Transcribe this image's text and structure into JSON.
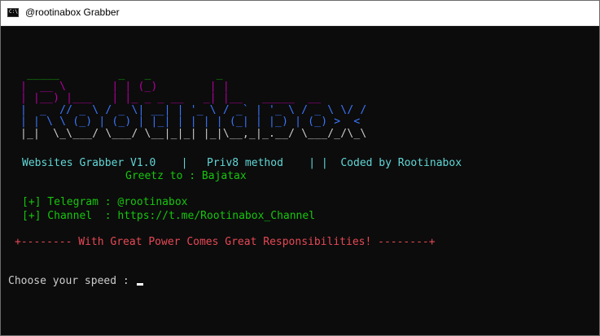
{
  "window": {
    "title": "@rootinabox Grabber",
    "icon_label": "C:\\."
  },
  "banner": {
    "lines": [
      {
        "text": " _____         _   _          _",
        "color": "#13a10e"
      },
      {
        "text": "|  __ \\       | | (_)        | |",
        "color": "#b4009e"
      },
      {
        "text": "| |__) |___   | |_ _ _ __   _| |__   _____  __",
        "color": "#b4009e"
      },
      {
        "text": "|  _  // _ \\ / _ \\| __| | '_ \\ / _` | '_ \\ / _ \\ \\/ /",
        "color": "#3b78ff"
      },
      {
        "text": "| | \\ \\ (_) | (_) | |_| | | | | (_| | |_) | (_) >  <",
        "color": "#3b78ff"
      },
      {
        "text": "|_|  \\_\\___/ \\___/ \\__|_|_| |_|\\__,_|_.__/ \\___/_/\\_\\",
        "color": "#cccccc"
      }
    ]
  },
  "info": {
    "line1": "Websites Grabber V1.0    |   Priv8 method    | |  Coded by Rootinabox",
    "line1_color": "#61d6d6",
    "line2": "Greetz to : Bajatax",
    "line2_color": "#16c60c"
  },
  "links": {
    "telegram": "[+] Telegram : @rootinabox",
    "channel": "[+] Channel  : https://t.me/Rootinabox_Channel",
    "color": "#16c60c"
  },
  "motto": {
    "text": "+-------- With Great Power Comes Great Responsibilities! --------+",
    "color": "#e74856"
  },
  "prompt": {
    "text": "Choose your speed : ",
    "color": "#cccccc"
  }
}
